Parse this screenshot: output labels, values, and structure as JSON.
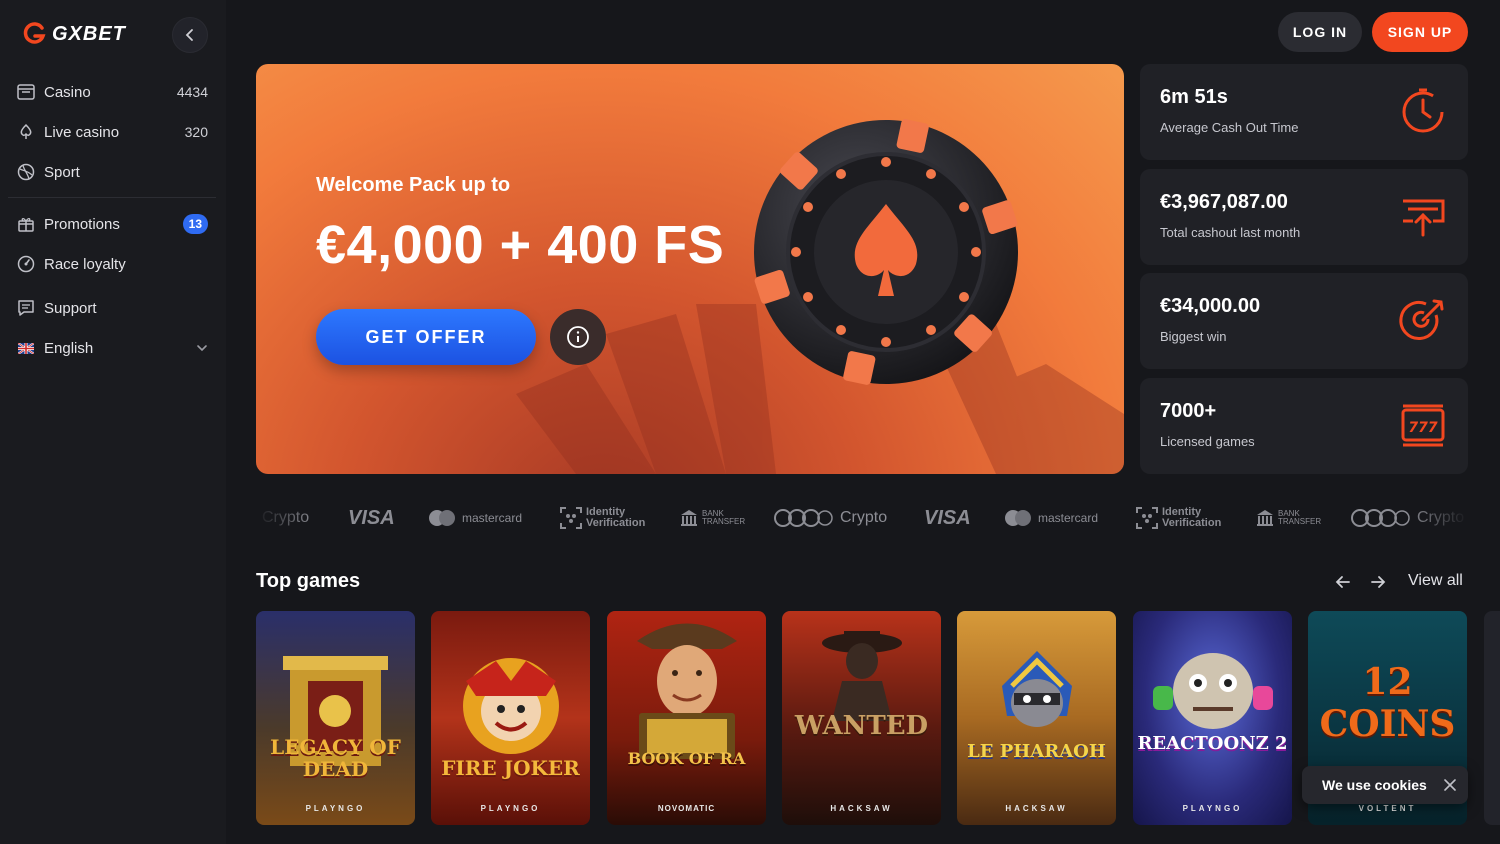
{
  "brand": {
    "name": "GXBET",
    "accent": "#f2471f",
    "blue": "#2f6bf2"
  },
  "sidebar": {
    "main": [
      {
        "label": "Casino",
        "count": "4434",
        "icon": "casino-icon"
      },
      {
        "label": "Live casino",
        "count": "320",
        "icon": "live-casino-icon"
      },
      {
        "label": "Sport",
        "count": "",
        "icon": "sport-icon"
      }
    ],
    "secondary": [
      {
        "label": "Promotions",
        "badge": "13",
        "icon": "gift-icon"
      },
      {
        "label": "Race loyalty",
        "icon": "race-icon"
      },
      {
        "label": "Support",
        "icon": "chat-icon"
      }
    ],
    "language": {
      "label": "English",
      "icon": "uk-flag-icon"
    }
  },
  "header": {
    "login": "LOG IN",
    "signup": "SIGN UP"
  },
  "hero": {
    "subtitle": "Welcome Pack up to",
    "title": "€4,000 + 400 FS",
    "cta": "GET OFFER"
  },
  "stats": [
    {
      "value": "6m 51s",
      "label": "Average Cash Out Time",
      "icon": "clock-icon"
    },
    {
      "value": "€3,967,087.00",
      "label": "Total cashout last month",
      "icon": "cashout-icon"
    },
    {
      "value": "€34,000.00",
      "label": "Biggest win",
      "icon": "target-icon"
    },
    {
      "value": "7000+",
      "label": "Licensed games",
      "icon": "slot-machine-icon"
    }
  ],
  "payments": {
    "crypto": "Crypto",
    "visa": "VISA",
    "mastercard": "mastercard",
    "id_line1": "Identity",
    "id_line2": "Verification",
    "bank_line1": "BANK",
    "bank_line2": "TRANSFER"
  },
  "top_games": {
    "title": "Top games",
    "view_all": "View all",
    "games": [
      {
        "name": "LEGACY OF DEAD",
        "provider": "PLAYNGO"
      },
      {
        "name": "FIRE JOKER",
        "provider": "PLAYNGO"
      },
      {
        "name": "BOOK OF RA",
        "provider": "NOVOMATIC"
      },
      {
        "name": "WANTED",
        "provider": "HACKSAW"
      },
      {
        "name": "LE PHARAOH",
        "provider": "HACKSAW"
      },
      {
        "name": "REACTOONZ 2",
        "provider": "PLAYNGO"
      },
      {
        "name": "12 COINS",
        "provider": "VOLTENT"
      }
    ]
  },
  "cookie": {
    "text": "We use cookies"
  }
}
